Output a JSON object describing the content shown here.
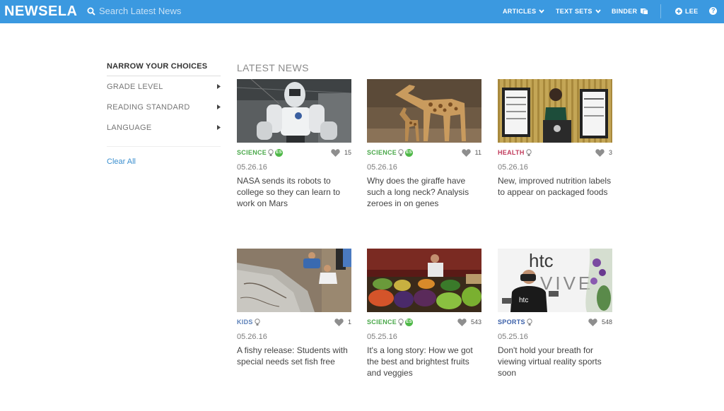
{
  "header": {
    "logo": "NEWSELA",
    "search_placeholder": "Search Latest News",
    "nav": {
      "articles": "ARTICLES",
      "text_sets": "TEXT SETS",
      "binder": "BINDER",
      "user": "LEE",
      "help": "?"
    }
  },
  "sidebar": {
    "title": "NARROW YOUR CHOICES",
    "filters": [
      "GRADE LEVEL",
      "READING STANDARD",
      "LANGUAGE"
    ],
    "clear_all": "Clear All"
  },
  "main": {
    "section_title": "LATEST NEWS",
    "articles": [
      {
        "category": "SCIENCE",
        "category_color": "#4aa84a",
        "spanish": true,
        "es_label": "ES",
        "likes": "15",
        "date": "05.26.16",
        "title": "NASA sends its robots to college so they can learn to work on Mars"
      },
      {
        "category": "SCIENCE",
        "category_color": "#4aa84a",
        "spanish": true,
        "es_label": "ES",
        "likes": "11",
        "date": "05.26.16",
        "title": "Why does the giraffe have such a long neck? Analysis zeroes in on genes"
      },
      {
        "category": "HEALTH",
        "category_color": "#c0395a",
        "spanish": false,
        "likes": "3",
        "date": "05.26.16",
        "title": "New, improved nutrition labels to appear on packaged foods"
      },
      {
        "category": "KIDS",
        "category_color": "#5a7fb8",
        "spanish": false,
        "likes": "1",
        "date": "05.26.16",
        "title": "A fishy release: Students with special needs set fish free"
      },
      {
        "category": "SCIENCE",
        "category_color": "#4aa84a",
        "spanish": true,
        "es_label": "ES",
        "likes": "543",
        "date": "05.25.16",
        "title": "It's a long story: How we got the best and brightest fruits and veggies"
      },
      {
        "category": "SPORTS",
        "category_color": "#3a5fa8",
        "spanish": false,
        "likes": "548",
        "date": "05.25.16",
        "title": "Don't hold your breath for viewing virtual reality sports soon"
      }
    ],
    "thumb_labels": {
      "htc": "htc",
      "vive": "VIVE",
      "shirt": "htc"
    }
  },
  "icons": [
    "search-icon",
    "chevron-down-icon",
    "book-icon",
    "plus-circle-icon",
    "help-icon",
    "chevron-right-icon",
    "lightbulb-icon",
    "heart-icon"
  ]
}
